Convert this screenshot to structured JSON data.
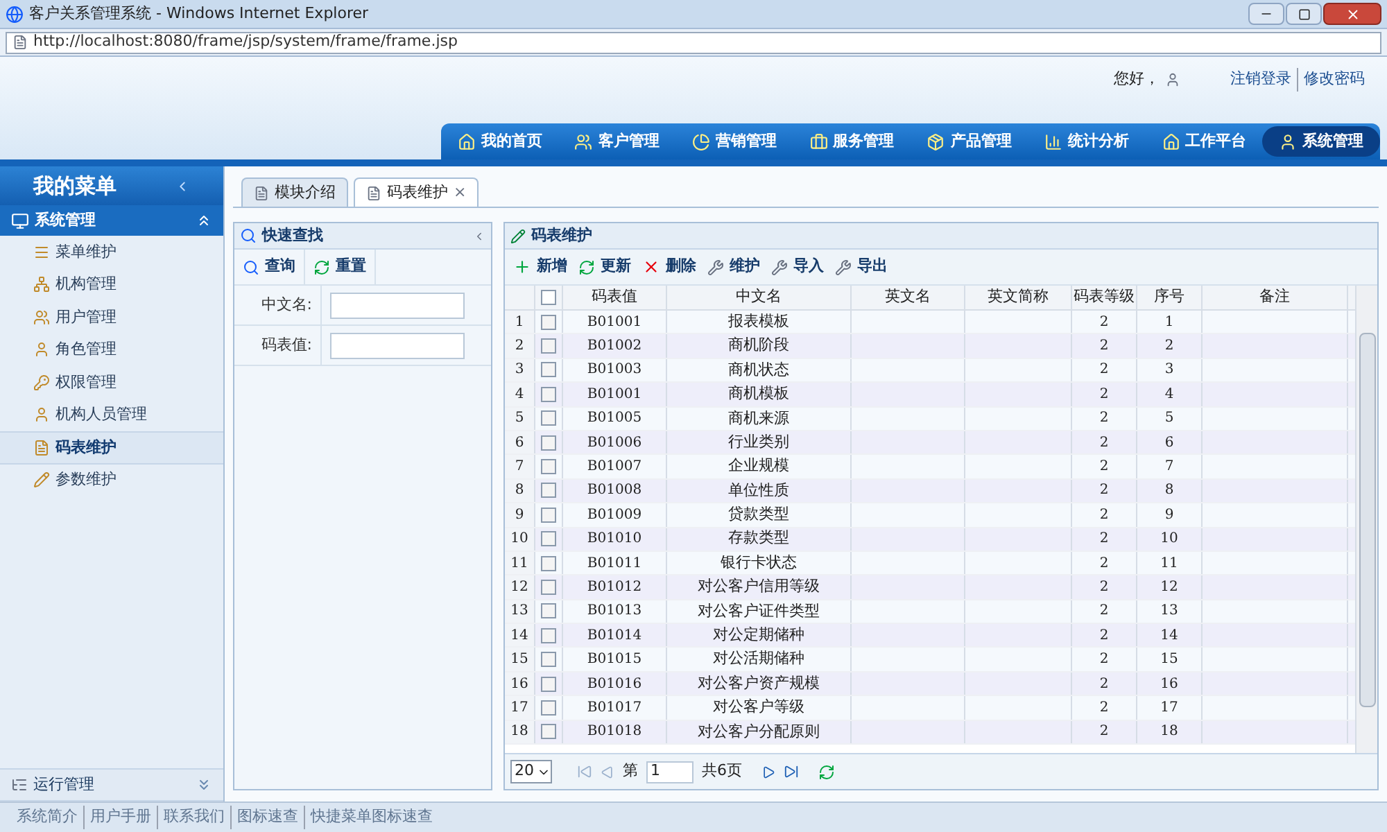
{
  "window": {
    "title": "客户关系管理系统 - Windows Internet Explorer",
    "address": "http://localhost:8080/frame/jsp/system/frame/frame.jsp"
  },
  "header": {
    "greeting": "您好，",
    "links": [
      "注销登录",
      "修改密码"
    ]
  },
  "nav": [
    {
      "label": "我的首页",
      "selected": false
    },
    {
      "label": "客户管理",
      "selected": false
    },
    {
      "label": "营销管理",
      "selected": false
    },
    {
      "label": "服务管理",
      "selected": false
    },
    {
      "label": "产品管理",
      "selected": false
    },
    {
      "label": "统计分析",
      "selected": false
    },
    {
      "label": "工作平台",
      "selected": false
    },
    {
      "label": "系统管理",
      "selected": true
    }
  ],
  "sidebar": {
    "title": "我的菜单",
    "group": "系统管理",
    "items": [
      {
        "label": "菜单维护",
        "selected": false
      },
      {
        "label": "机构管理",
        "selected": false
      },
      {
        "label": "用户管理",
        "selected": false
      },
      {
        "label": "角色管理",
        "selected": false
      },
      {
        "label": "权限管理",
        "selected": false
      },
      {
        "label": "机构人员管理",
        "selected": false
      },
      {
        "label": "码表维护",
        "selected": true
      },
      {
        "label": "参数维护",
        "selected": false
      }
    ],
    "bottom_group": "运行管理"
  },
  "tabs": [
    {
      "label": "模块介绍",
      "selected": false,
      "closable": false
    },
    {
      "label": "码表维护",
      "selected": true,
      "closable": true
    }
  ],
  "close_glyph": "×",
  "search_panel": {
    "title": "快速查找",
    "buttons": [
      "查询",
      "重置"
    ],
    "fields": [
      {
        "label": "中文名:"
      },
      {
        "label": "码表值:"
      }
    ]
  },
  "grid": {
    "title": "码表维护",
    "all_checked": false,
    "toolbar": [
      {
        "label": "新增",
        "kind": "add"
      },
      {
        "label": "更新",
        "kind": "refresh"
      },
      {
        "label": "删除",
        "kind": "delete"
      },
      {
        "label": "维护",
        "kind": "wrench"
      },
      {
        "label": "导入",
        "kind": "wrench"
      },
      {
        "label": "导出",
        "kind": "wrench"
      }
    ],
    "columns": [
      "码表值",
      "中文名",
      "英文名",
      "英文简称",
      "码表等级",
      "序号",
      "备注"
    ],
    "rows": [
      {
        "n": "1",
        "code": "B01001",
        "name": "报表模板",
        "level": "2",
        "order": "1",
        "checked": false
      },
      {
        "n": "2",
        "code": "B01002",
        "name": "商机阶段",
        "level": "2",
        "order": "2",
        "checked": false
      },
      {
        "n": "3",
        "code": "B01003",
        "name": "商机状态",
        "level": "2",
        "order": "3",
        "checked": false
      },
      {
        "n": "4",
        "code": "B01001",
        "name": "商机模板",
        "level": "2",
        "order": "4",
        "checked": false
      },
      {
        "n": "5",
        "code": "B01005",
        "name": "商机来源",
        "level": "2",
        "order": "5",
        "checked": false
      },
      {
        "n": "6",
        "code": "B01006",
        "name": "行业类别",
        "level": "2",
        "order": "6",
        "checked": false
      },
      {
        "n": "7",
        "code": "B01007",
        "name": "企业规模",
        "level": "2",
        "order": "7",
        "checked": false
      },
      {
        "n": "8",
        "code": "B01008",
        "name": "单位性质",
        "level": "2",
        "order": "8",
        "checked": false
      },
      {
        "n": "9",
        "code": "B01009",
        "name": "贷款类型",
        "level": "2",
        "order": "9",
        "checked": false
      },
      {
        "n": "10",
        "code": "B01010",
        "name": "存款类型",
        "level": "2",
        "order": "10",
        "checked": false
      },
      {
        "n": "11",
        "code": "B01011",
        "name": "银行卡状态",
        "level": "2",
        "order": "11",
        "checked": false
      },
      {
        "n": "12",
        "code": "B01012",
        "name": "对公客户信用等级",
        "level": "2",
        "order": "12",
        "checked": false
      },
      {
        "n": "13",
        "code": "B01013",
        "name": "对公客户证件类型",
        "level": "2",
        "order": "13",
        "checked": false
      },
      {
        "n": "14",
        "code": "B01014",
        "name": "对公定期储种",
        "level": "2",
        "order": "14",
        "checked": false
      },
      {
        "n": "15",
        "code": "B01015",
        "name": "对公活期储种",
        "level": "2",
        "order": "15",
        "checked": false
      },
      {
        "n": "16",
        "code": "B01016",
        "name": "对公客户资产规模",
        "level": "2",
        "order": "16",
        "checked": false
      },
      {
        "n": "17",
        "code": "B01017",
        "name": "对公客户等级",
        "level": "2",
        "order": "17",
        "checked": false
      },
      {
        "n": "18",
        "code": "B01018",
        "name": "对公客户分配原则",
        "level": "2",
        "order": "18",
        "checked": false
      }
    ],
    "pager": {
      "page_size": "20",
      "page_prefix": "第",
      "page": "1",
      "total": "共6页"
    }
  },
  "footer": [
    "系统简介",
    "用户手册",
    "联系我们",
    "图标速查",
    "快捷菜单图标速查"
  ]
}
